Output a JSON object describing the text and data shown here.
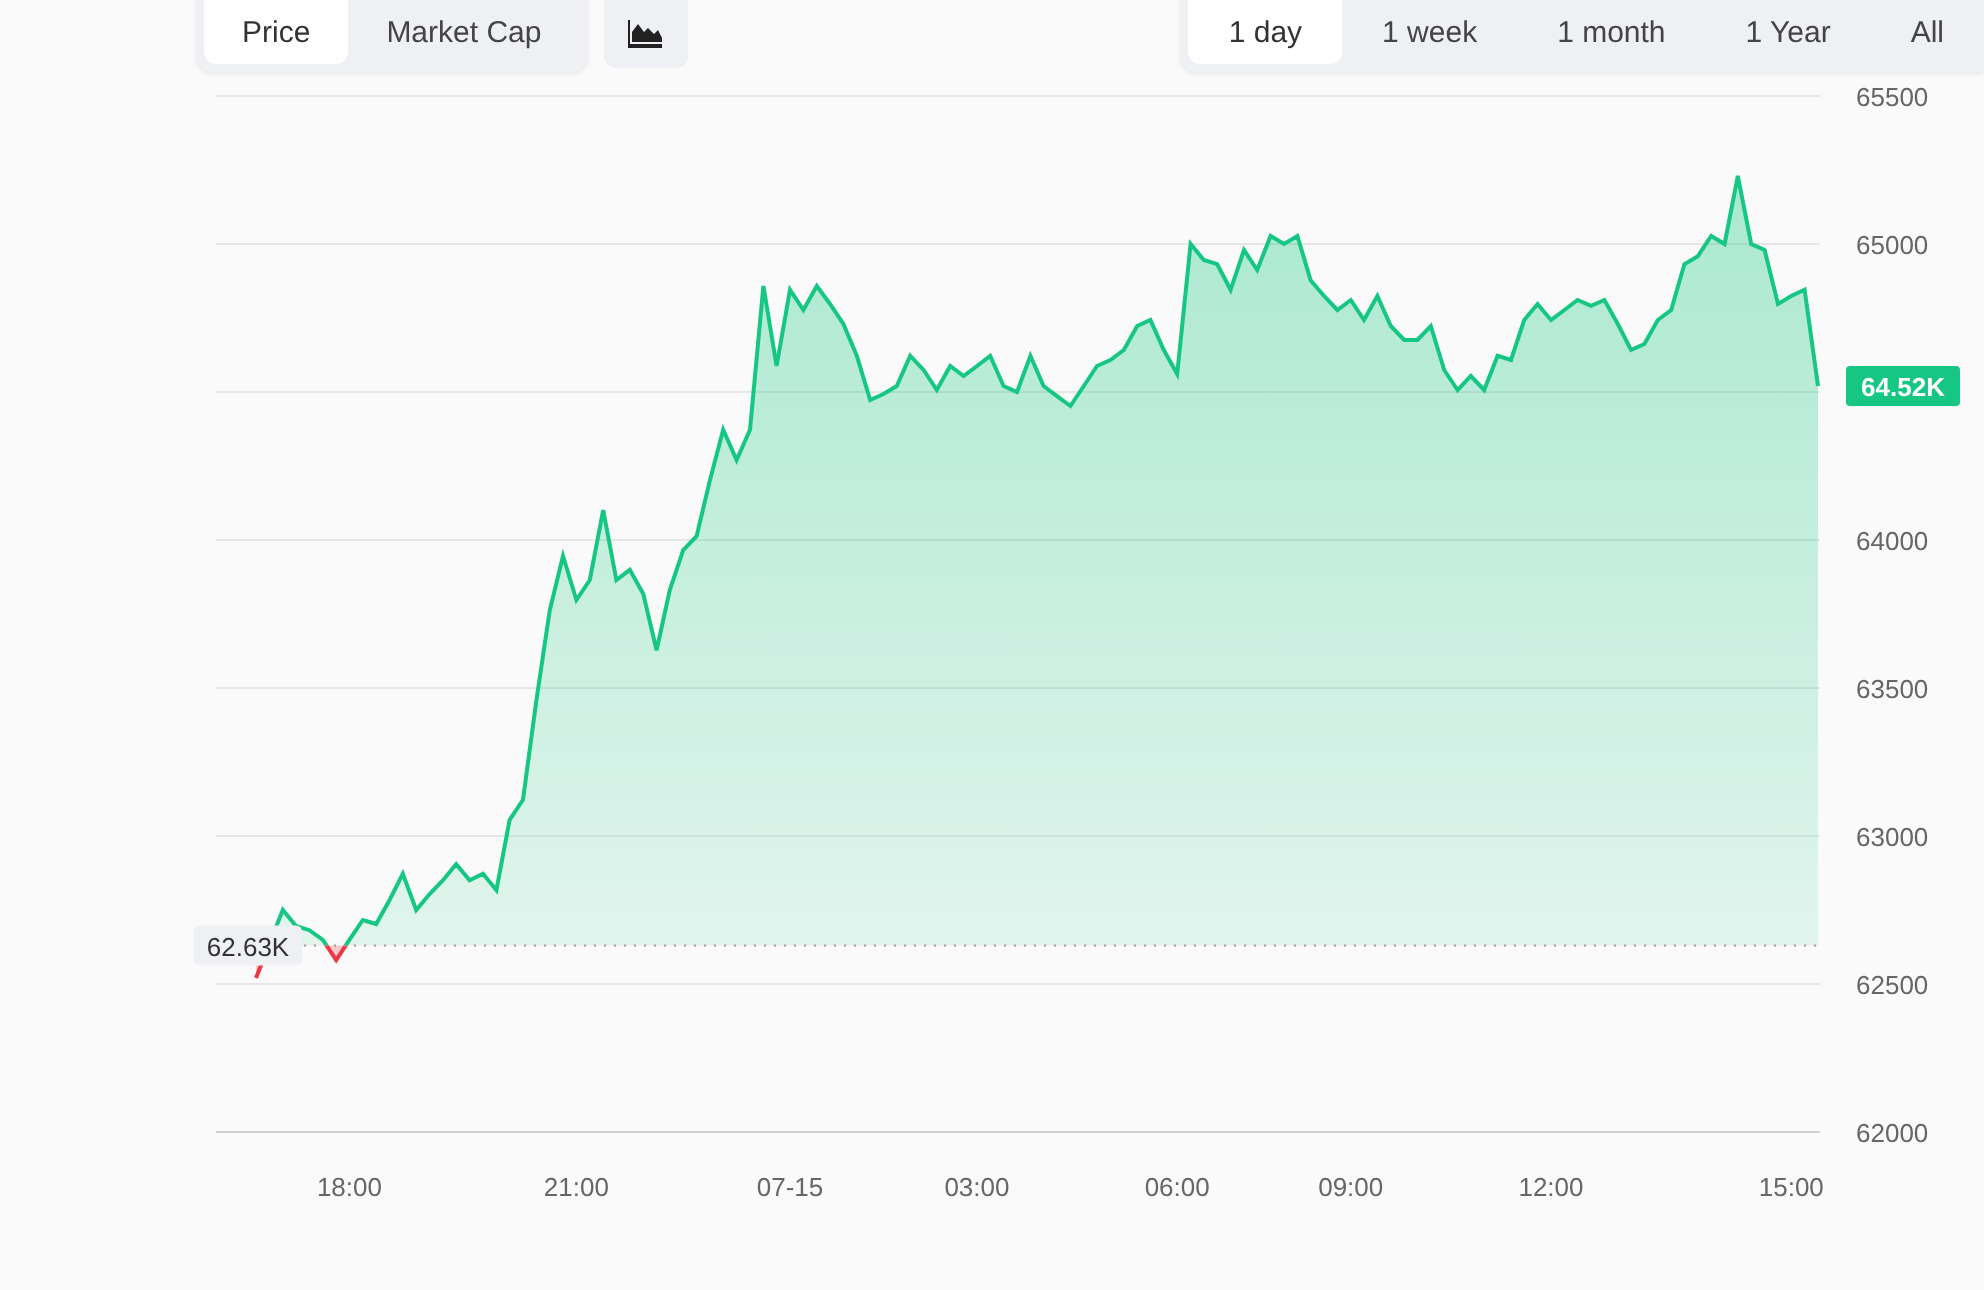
{
  "metric_tabs": [
    {
      "label": "Price",
      "selected": true
    },
    {
      "label": "Market Cap",
      "selected": false
    }
  ],
  "range_tabs": [
    {
      "label": "1 day",
      "selected": true
    },
    {
      "label": "1 week",
      "selected": false
    },
    {
      "label": "1 month",
      "selected": false
    },
    {
      "label": "1 Year",
      "selected": false
    },
    {
      "label": "All",
      "selected": false
    }
  ],
  "chart_data": {
    "type": "area",
    "categories": [
      null,
      null,
      null,
      null,
      null,
      null,
      null,
      "18:00",
      null,
      null,
      null,
      null,
      null,
      null,
      null,
      null,
      null,
      null,
      null,
      null,
      null,
      null,
      null,
      null,
      "21:00",
      null,
      null,
      null,
      null,
      null,
      null,
      null,
      null,
      null,
      null,
      null,
      null,
      null,
      null,
      null,
      "07-15",
      null,
      null,
      null,
      null,
      null,
      null,
      null,
      null,
      null,
      null,
      null,
      null,
      null,
      "03:00",
      null,
      null,
      null,
      null,
      null,
      null,
      null,
      null,
      null,
      null,
      null,
      null,
      null,
      null,
      "06:00",
      null,
      null,
      null,
      null,
      null,
      null,
      null,
      null,
      null,
      null,
      null,
      null,
      "09:00",
      null,
      null,
      null,
      null,
      null,
      null,
      null,
      null,
      null,
      null,
      null,
      null,
      null,
      null,
      "12:00",
      null,
      null,
      null,
      null,
      null,
      null,
      null,
      null,
      null,
      null,
      null,
      null,
      null,
      null,
      null,
      null,
      null,
      "15:00",
      null,
      null
    ],
    "series": [
      {
        "color": "#16c784",
        "values": [
          62520,
          null,
          62750,
          62696,
          62682,
          62649,
          62581,
          62649,
          62716,
          62703,
          62784,
          62872,
          62750,
          62804,
          62851,
          62905,
          62851,
          62872,
          62817,
          63054,
          63122,
          63459,
          63763,
          63946,
          63797,
          63865,
          64101,
          63865,
          63899,
          63818,
          63628,
          63831,
          63966,
          64013,
          64203,
          64372,
          64270,
          64372,
          64858,
          64588,
          64845,
          64777,
          64858,
          64797,
          64730,
          64622,
          64473,
          64493,
          64520,
          64622,
          64574,
          64507,
          64588,
          64554,
          64588,
          64622,
          64520,
          64500,
          64622,
          64520,
          64486,
          64453,
          64520,
          64588,
          64608,
          64642,
          64723,
          64743,
          64642,
          64561,
          65000,
          64946,
          64932,
          64845,
          64980,
          64912,
          65027,
          65000,
          65027,
          64878,
          64824,
          64777,
          64811,
          64743,
          64824,
          64723,
          64676,
          64676,
          64723,
          64574,
          64507,
          64554,
          64507,
          64622,
          64608,
          64743,
          64797,
          64743,
          64777,
          64811,
          64791,
          64811,
          64730,
          64642,
          64662,
          64743,
          64777,
          64932,
          64959,
          65027,
          65000,
          65230,
          65000,
          64980,
          64797,
          64824,
          64845,
          64520
        ]
      }
    ],
    "ylim": [
      62000,
      65500
    ],
    "grid": true,
    "yticks": [
      62000,
      62500,
      63000,
      63500,
      64000,
      {
        "value": 64520,
        "label": "64.52K"
      },
      65000,
      65500
    ],
    "ref_lines": [
      {
        "axis": "y",
        "value": 62630,
        "label": "62.63K"
      }
    ]
  }
}
